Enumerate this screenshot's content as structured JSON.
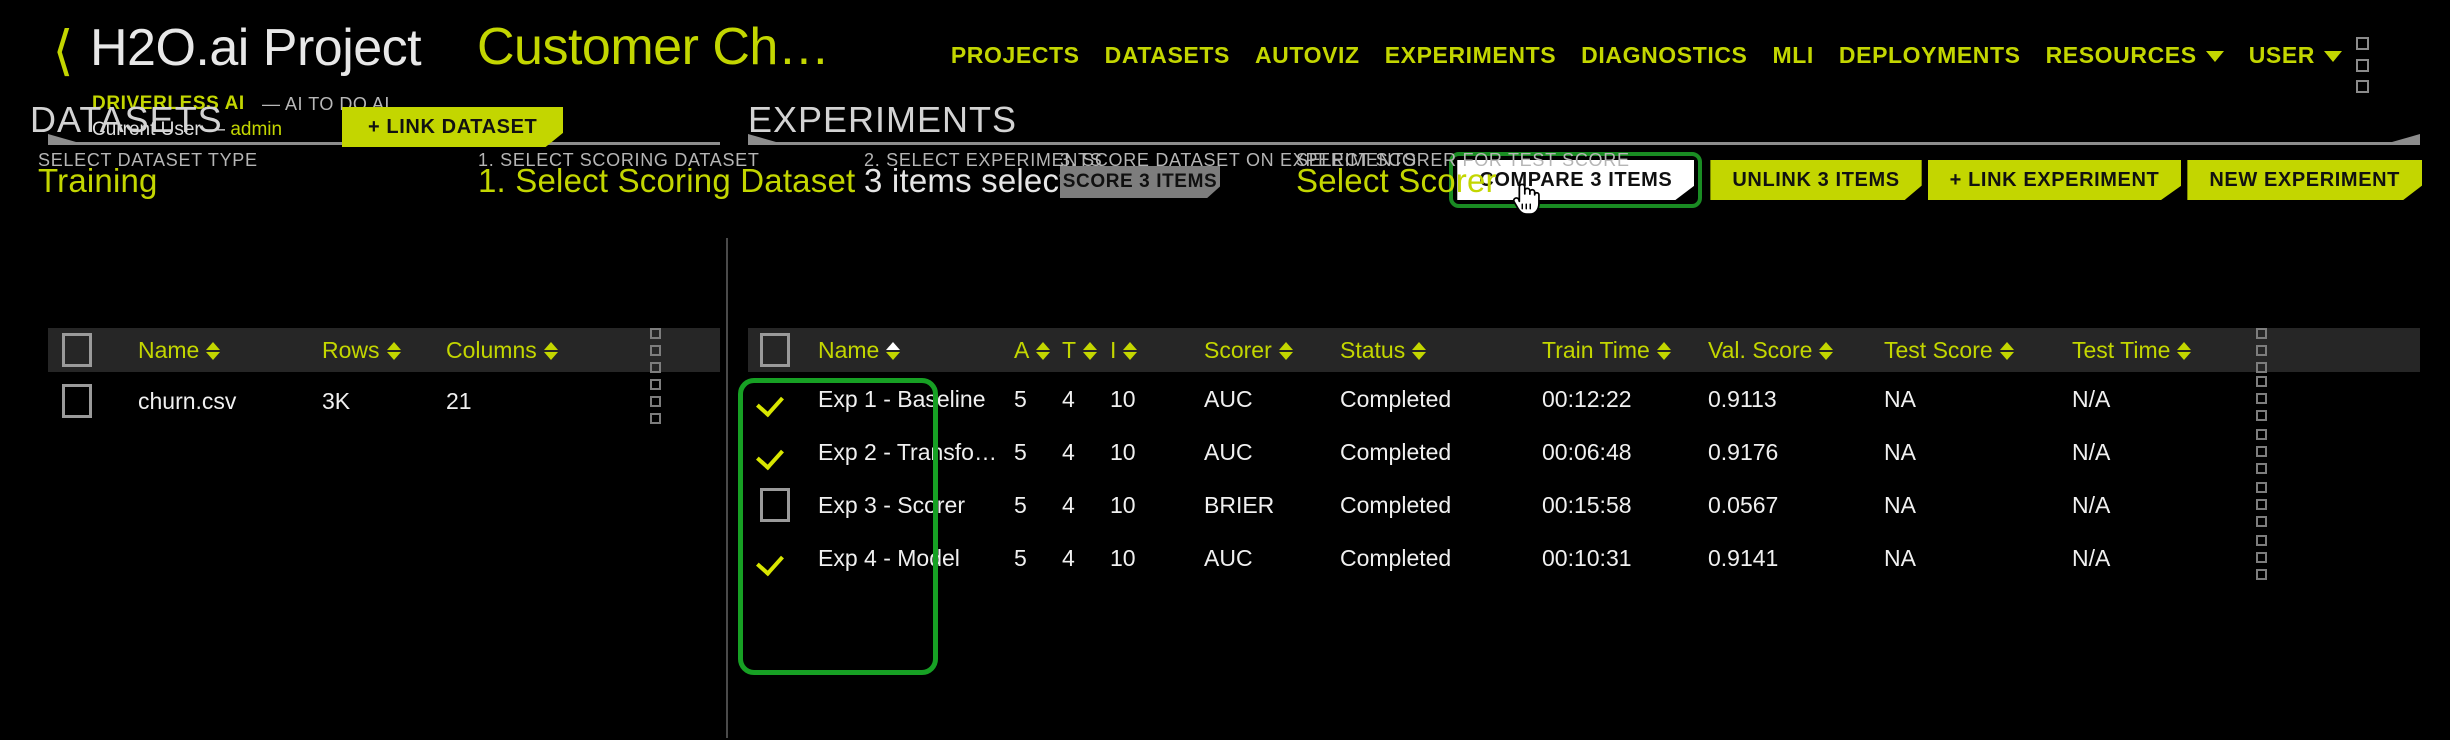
{
  "header": {
    "back_icon": "chevron-left-icon",
    "brand": "H2O.ai Project",
    "project_name": "Customer Ch…",
    "product": "DRIVERLESS AI",
    "tagline": "— AI TO DO AI",
    "current_user_label": "Current User —",
    "current_user": "admin",
    "accent": "#c3d600",
    "nav": [
      {
        "label": "PROJECTS",
        "has_caret": false
      },
      {
        "label": "DATASETS",
        "has_caret": false
      },
      {
        "label": "AUTOVIZ",
        "has_caret": false
      },
      {
        "label": "EXPERIMENTS",
        "has_caret": false
      },
      {
        "label": "DIAGNOSTICS",
        "has_caret": false
      },
      {
        "label": "MLI",
        "has_caret": false
      },
      {
        "label": "DEPLOYMENTS",
        "has_caret": false
      },
      {
        "label": "RESOURCES",
        "has_caret": true
      },
      {
        "label": "USER",
        "has_caret": true
      }
    ],
    "kebab_icon": "vertical-dots-icon"
  },
  "datasets_panel": {
    "title": "DATASETS",
    "link_dataset_label": "+ LINK DATASET",
    "select_type_caption": "SELECT DATASET TYPE",
    "select_type_value": "Training",
    "table": {
      "columns": [
        "Name",
        "Rows",
        "Columns"
      ],
      "rows": [
        {
          "checked": false,
          "name": "churn.csv",
          "rows": "3K",
          "columns": "21"
        }
      ]
    }
  },
  "experiments_panel": {
    "title": "EXPERIMENTS",
    "steps": {
      "step1_caption": "1. SELECT SCORING DATASET",
      "step1_value": "1. Select Scoring Dataset",
      "step2_caption": "2. SELECT EXPERIMENTS",
      "step2_value": "3 items selected",
      "step3_caption": "3. SCORE DATASET ON EXPERIMENTS",
      "step3_button": "SCORE 3 ITEMS",
      "scorer_caption": "SELECT SCORER FOR TEST SCORE",
      "scorer_value": "Select Scorer"
    },
    "actions": {
      "compare": "COMPARE 3 ITEMS",
      "unlink": "UNLINK 3 ITEMS",
      "link_experiment": "+ LINK EXPERIMENT",
      "new_experiment": "NEW EXPERIMENT",
      "compare_highlight_color": "#1a8c23",
      "cursor_icon": "hand-pointer-cursor"
    },
    "table": {
      "columns": [
        "Name",
        "A",
        "T",
        "I",
        "Scorer",
        "Status",
        "Train Time",
        "Val. Score",
        "Test Score",
        "Test Time"
      ],
      "active_sort_column": "Name",
      "rows": [
        {
          "checked": true,
          "name": "Exp 1 - Baseline",
          "a": "5",
          "t": "4",
          "i": "10",
          "scorer": "AUC",
          "status": "Completed",
          "train_time": "00:12:22",
          "val_score": "0.9113",
          "test_score": "NA",
          "test_time": "N/A"
        },
        {
          "checked": true,
          "name": "Exp 2 - Transfo…",
          "a": "5",
          "t": "4",
          "i": "10",
          "scorer": "AUC",
          "status": "Completed",
          "train_time": "00:06:48",
          "val_score": "0.9176",
          "test_score": "NA",
          "test_time": "N/A"
        },
        {
          "checked": false,
          "name": "Exp 3 - Scorer",
          "a": "5",
          "t": "4",
          "i": "10",
          "scorer": "BRIER",
          "status": "Completed",
          "train_time": "00:15:58",
          "val_score": "0.0567",
          "test_score": "NA",
          "test_time": "N/A"
        },
        {
          "checked": true,
          "name": "Exp 4 - Model",
          "a": "5",
          "t": "4",
          "i": "10",
          "scorer": "AUC",
          "status": "Completed",
          "train_time": "00:10:31",
          "val_score": "0.9141",
          "test_score": "NA",
          "test_time": "N/A"
        }
      ]
    }
  }
}
